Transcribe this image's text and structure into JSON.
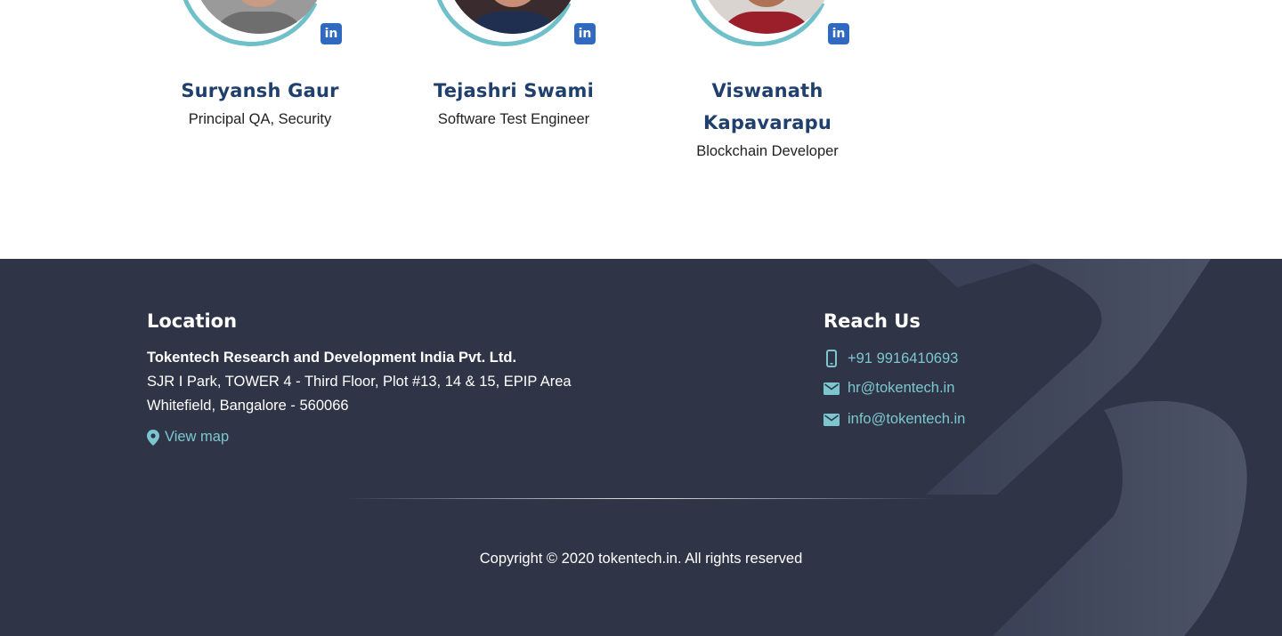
{
  "team": {
    "members": [
      {
        "name": "Suryansh Gaur",
        "role": "Principal QA, Security",
        "linkedin_label": "in"
      },
      {
        "name": "Tejashri Swami",
        "role": "Software Test Engineer",
        "linkedin_label": "in"
      },
      {
        "name": "Viswanath Kapavarapu",
        "role": "Blockchain Developer",
        "linkedin_label": "in"
      }
    ]
  },
  "footer": {
    "location": {
      "title": "Location",
      "company": "Tokentech Research and Development India Pvt. Ltd.",
      "address_line1": "SJR I Park, TOWER 4 - Third Floor, Plot #13, 14 & 15, EPIP Area",
      "address_line2": "Whitefield, Bangalore - 560066",
      "view_map": "View map"
    },
    "reach_us": {
      "title": "Reach Us",
      "phone": "+91 9916410693",
      "email_hr": "hr@tokentech.in",
      "email_info": "info@tokentech.in"
    },
    "copyright": "Copyright © 2020 tokentech.in. All rights reserved"
  },
  "colors": {
    "footer_bg": "#2f3547",
    "accent_teal": "#7cc7cf",
    "name_navy": "#1f3f6d",
    "linkedin_blue": "#2f6ac0"
  },
  "icons": [
    "linkedin-icon",
    "map-pin-icon",
    "phone-icon",
    "mail-icon"
  ]
}
